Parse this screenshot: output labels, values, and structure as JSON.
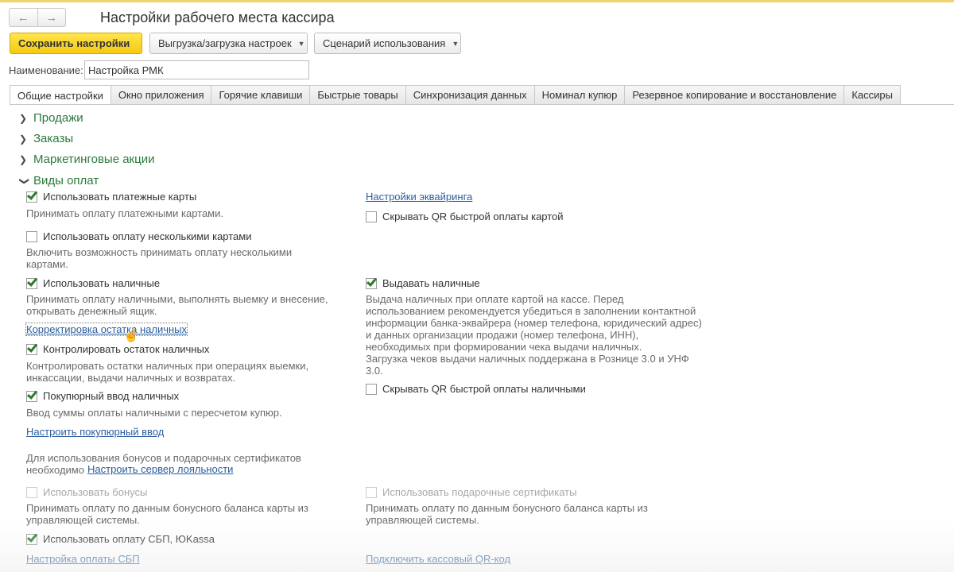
{
  "window": {
    "title": "Настройки рабочего места кассира"
  },
  "toolbar": {
    "save": "Сохранить настройки",
    "export_import": "Выгрузка/загрузка настроек",
    "scenario": "Сценарий использования"
  },
  "name_field": {
    "label": "Наименование:",
    "value": "Настройка РМК"
  },
  "tabs": [
    "Общие настройки",
    "Окно приложения",
    "Горячие клавиши",
    "Быстрые товары",
    "Синхронизация данных",
    "Номинал купюр",
    "Резервное копирование и восстановление",
    "Кассиры"
  ],
  "active_tab_index": 0,
  "sections": {
    "sales": "Продажи",
    "orders": "Заказы",
    "marketing": "Маркетинговые акции",
    "payments": "Виды оплат"
  },
  "payments": {
    "cards": {
      "label": "Использовать платежные карты",
      "checked": true,
      "desc": "Принимать оплату платежными картами."
    },
    "acquiring_link": "Настройки эквайринга",
    "hide_qr_card": {
      "label": "Скрывать QR быстрой оплаты картой",
      "checked": false
    },
    "multi_cards": {
      "label": "Использовать оплату несколькими картами",
      "checked": false,
      "desc_1": "Включить возможность принимать оплату несколькими",
      "desc_2": "картами."
    },
    "cash": {
      "label": "Использовать наличные",
      "checked": true,
      "desc_1": "Принимать оплату наличными, выполнять выемку и внесение,",
      "desc_2": "открывать денежный ящик."
    },
    "cash_out": {
      "label": "Выдавать наличные",
      "checked": true,
      "desc": [
        "Выдача наличных при оплате картой на кассе. Перед",
        "использованием рекомендуется убедиться в заполнении контактной",
        "информации банка-эквайрера (номер телефона, юридический адрес)",
        "и данных организации продажи (номер телефона, ИНН),",
        "необходимых при формировании чека выдачи наличных.",
        "Загрузка чеков выдачи наличных поддержана в Рознице 3.0 и УНФ",
        "3.0."
      ]
    },
    "cash_correction_link": "Корректировка остатка наличных",
    "control_cash": {
      "label": "Контролировать остаток наличных",
      "checked": true,
      "desc_1": "Контролировать остатки наличных при операциях выемки,",
      "desc_2": "инкассации, выдачи наличных и возвратах."
    },
    "hide_qr_cash": {
      "label": "Скрывать QR быстрой оплаты наличными",
      "checked": false
    },
    "denomination_input": {
      "label": "Покупюрный ввод наличных",
      "checked": true,
      "desc": "Ввод суммы оплаты наличными с пересчетом купюр."
    },
    "setup_denomination_link": "Настроить покупюрный ввод",
    "loyalty_note_1": "Для использования бонусов и подарочных сертификатов",
    "loyalty_note_2": "необходимо",
    "loyalty_server_link": "Настроить сервер лояльности",
    "bonuses": {
      "label": "Использовать бонусы",
      "checked": false,
      "desc_1": "Принимать оплату по данным бонусного баланса карты из",
      "desc_2": "управляющей системы."
    },
    "gift_certs": {
      "label": "Использовать подарочные сертификаты",
      "checked": false,
      "desc_1": "Принимать оплату по данным бонусного баланса карты из",
      "desc_2": "управляющей системы."
    },
    "sbp": {
      "label": "Использовать оплату СБП, ЮKassa",
      "checked": true
    },
    "sbp_setup_link": "Настройка оплаты СБП",
    "qr_connect_link": "Подключить кассовый QR-код"
  }
}
